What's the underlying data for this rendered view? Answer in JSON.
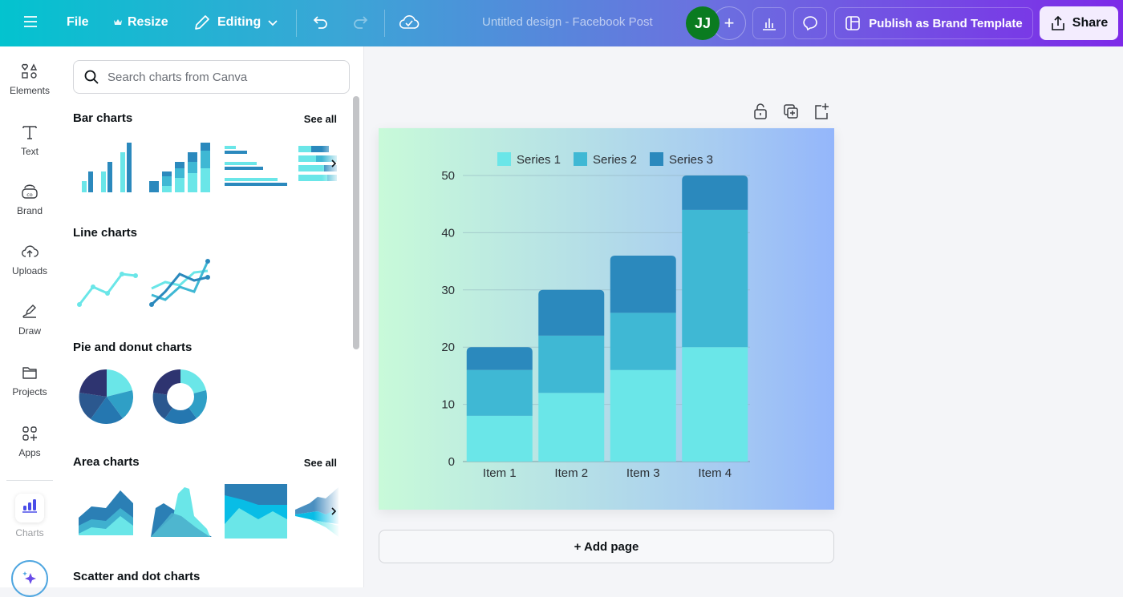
{
  "topbar": {
    "file_label": "File",
    "resize_label": "Resize",
    "editing_label": "Editing",
    "design_title": "Untitled design - Facebook Post",
    "avatar_initials": "JJ",
    "publish_label": "Publish as Brand Template",
    "share_label": "Share"
  },
  "rail": {
    "items": [
      {
        "label": "Elements",
        "icon": "shapes-icon"
      },
      {
        "label": "Text",
        "icon": "text-icon"
      },
      {
        "label": "Brand",
        "icon": "brand-icon"
      },
      {
        "label": "Uploads",
        "icon": "upload-cloud-icon"
      },
      {
        "label": "Draw",
        "icon": "pen-icon"
      },
      {
        "label": "Projects",
        "icon": "folder-icon"
      },
      {
        "label": "Apps",
        "icon": "apps-icon"
      },
      {
        "label": "Charts",
        "icon": "bar-chart-icon"
      }
    ],
    "accent": "#4a4de8"
  },
  "panel": {
    "search_placeholder": "Search charts from Canva",
    "sections": [
      {
        "title": "Bar charts",
        "see_all": "See all"
      },
      {
        "title": "Line charts"
      },
      {
        "title": "Pie and donut charts"
      },
      {
        "title": "Area charts",
        "see_all": "See all"
      },
      {
        "title": "Scatter and dot charts"
      }
    ]
  },
  "canvas": {
    "add_page_label": "+ Add page"
  },
  "chart_data": {
    "type": "bar",
    "stacked": true,
    "categories": [
      "Item 1",
      "Item 2",
      "Item 3",
      "Item 4"
    ],
    "series": [
      {
        "name": "Series 1",
        "values": [
          8,
          12,
          16,
          20
        ],
        "color": "#6ae6e8"
      },
      {
        "name": "Series 2",
        "values": [
          8,
          10,
          10,
          24
        ],
        "color": "#3fb8d4"
      },
      {
        "name": "Series 3",
        "values": [
          4,
          8,
          10,
          6
        ],
        "color": "#2b89bd"
      }
    ],
    "yticks": [
      "0",
      "10",
      "20",
      "30",
      "40",
      "50"
    ],
    "ylim": [
      0,
      50
    ],
    "grid": true,
    "legend": "top",
    "title": "",
    "xlabel": "",
    "ylabel": ""
  }
}
